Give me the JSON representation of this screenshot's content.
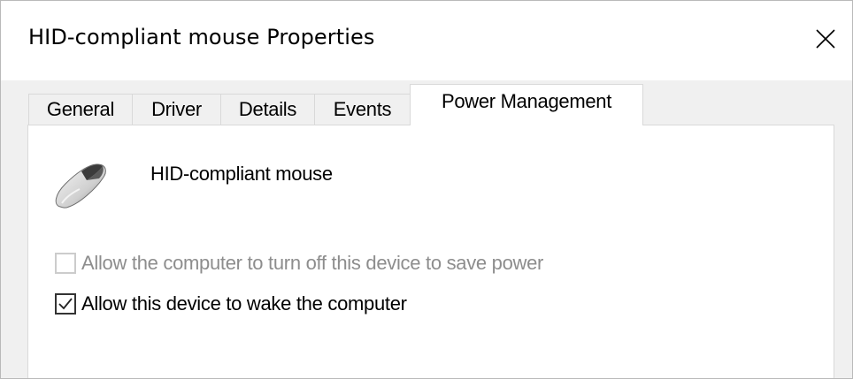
{
  "window": {
    "title": "HID-compliant mouse Properties",
    "close_icon": "close-icon"
  },
  "tabs": [
    {
      "label": "General",
      "active": false
    },
    {
      "label": "Driver",
      "active": false
    },
    {
      "label": "Details",
      "active": false
    },
    {
      "label": "Events",
      "active": false
    },
    {
      "label": "Power Management",
      "active": true
    }
  ],
  "device": {
    "icon": "mouse-icon",
    "name": "HID-compliant mouse"
  },
  "options": [
    {
      "label": "Allow the computer to turn off this device to save power",
      "checked": false,
      "enabled": false
    },
    {
      "label": "Allow this device to wake the computer",
      "checked": true,
      "enabled": true
    }
  ],
  "colors": {
    "disabled_text": "#8d8d8d",
    "border": "#d9d9d9",
    "window_bg": "#f0f0f0"
  }
}
